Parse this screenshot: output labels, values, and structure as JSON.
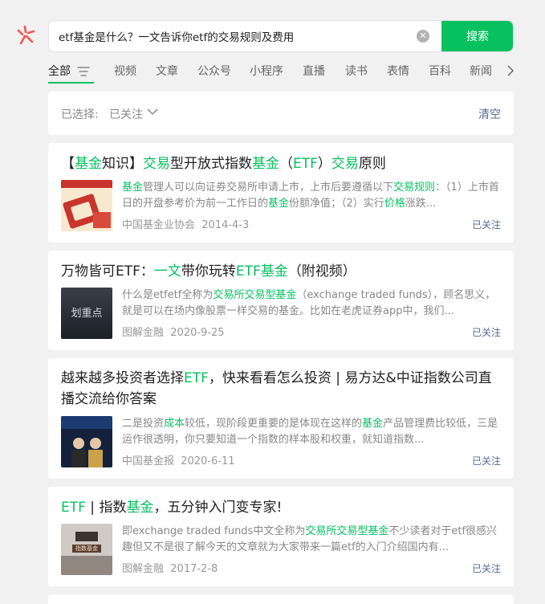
{
  "search": {
    "query": "etf基金是什么？一文告诉你etf的交易规则及费用",
    "button_label": "搜索"
  },
  "tabs": [
    "全部",
    "视频",
    "文章",
    "公众号",
    "小程序",
    "直播",
    "读书",
    "表情",
    "百科",
    "新闻"
  ],
  "filter": {
    "label": "已选择:",
    "value": "已关注",
    "clear_label": "清空"
  },
  "results": [
    {
      "title_parts": [
        [
          "【",
          false
        ],
        [
          "基金",
          true
        ],
        [
          "知识】",
          false
        ],
        [
          "交易",
          true
        ],
        [
          "型开放式指数",
          false
        ],
        [
          "基金",
          true
        ],
        [
          "（",
          false
        ],
        [
          "ETF",
          true
        ],
        [
          "）",
          false
        ],
        [
          "交易",
          true
        ],
        [
          "原则",
          false
        ]
      ],
      "snippet_parts": [
        [
          "基金",
          true
        ],
        [
          "管理人可以向证券交易所申请上市，上市后要遵循以下",
          false
        ],
        [
          "交易规则",
          true
        ],
        [
          "：（1）上市首日的开盘参考价为前一工作日的",
          false
        ],
        [
          "基金",
          true
        ],
        [
          "份额净值；（2）实行",
          false
        ],
        [
          "价格",
          true
        ],
        [
          "涨跌...",
          false
        ]
      ],
      "source": "中国基金业协会",
      "date": "2014-4-3",
      "follow": "已关注"
    },
    {
      "title_parts": [
        [
          "万物皆可ETF：",
          false
        ],
        [
          "一文",
          true
        ],
        [
          "带你玩转",
          false
        ],
        [
          "ETF基金",
          true
        ],
        [
          "（附视频）",
          false
        ]
      ],
      "snippet_parts": [
        [
          "什么是etfetf全称为",
          false
        ],
        [
          "交易所交易型基金",
          true
        ],
        [
          "（exchange traded funds），顾名思义，就是可以在场内像股票一样交易的基金。比如在老虎证券app中，我们...",
          false
        ]
      ],
      "source": "图解金融",
      "date": "2020-9-25",
      "follow": "已关注",
      "thumb_text": "划重点"
    },
    {
      "title_parts": [
        [
          "越来越多投资者选择",
          false
        ],
        [
          "ETF",
          true
        ],
        [
          "，快来看看怎么投资 | 易方达&中证指数公司直播交流给你答案",
          false
        ]
      ],
      "snippet_parts": [
        [
          "二是投资",
          false
        ],
        [
          "成本",
          true
        ],
        [
          "较低，现阶段更重要的是体现在这样的",
          false
        ],
        [
          "基金",
          true
        ],
        [
          "产品管理费比较低，三是运作很透明，你只要知道一个指数的样本股和权重，就知道指数...",
          false
        ]
      ],
      "source": "中国基金报",
      "date": "2020-6-11",
      "follow": "已关注"
    },
    {
      "title_parts": [
        [
          "ETF",
          true
        ],
        [
          " | 指数",
          false
        ],
        [
          "基金",
          true
        ],
        [
          "，五分钟入门变专家!",
          false
        ]
      ],
      "snippet_parts": [
        [
          "即exchange traded funds中文全称为",
          false
        ],
        [
          "交易所交易型基金",
          true
        ],
        [
          "不少读者对于etf很感兴趣但又不是很了解今天的文章就为大家带来一篇etf的入门介绍国内有...",
          false
        ]
      ],
      "source": "图解金融",
      "date": "2017-2-8",
      "follow": "已关注",
      "thumb_text": "指数基金"
    }
  ],
  "colors": {
    "accent": "#07c160",
    "link": "#576b95",
    "logo": "#fa5151"
  },
  "icons": {
    "logo": "wechat-search-logo-icon",
    "clear": "clear-x-icon",
    "filter": "filter-icon",
    "chevron": "chevron-down-icon",
    "more": "chevron-right-icon"
  }
}
